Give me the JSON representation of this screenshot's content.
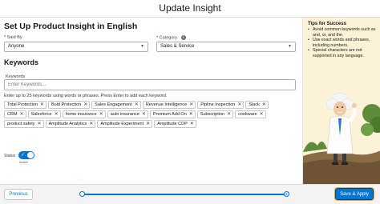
{
  "modal": {
    "title": "Update Insight"
  },
  "form": {
    "heading": "Set Up Product Insight in English",
    "said_by": {
      "required_mark": "*",
      "label": "Said By",
      "value": "Anyone"
    },
    "category": {
      "required_mark": "*",
      "label": "Category",
      "value": "Sales & Service",
      "info": "i"
    },
    "keywords_section": "Keywords",
    "keywords_label": "Keywords",
    "keywords_placeholder": "Enter Keywords...",
    "keywords_hint": "Enter up to 25 keywords using words or phrases. Press Enter to add each keyword.",
    "keywords": [
      "Total Protection",
      "Bold Protection",
      "Sales Engagement",
      "Revenue Intelligence",
      "Pipline Inspection",
      "Slack",
      "CRM",
      "Salesforce",
      "home insurance",
      "auto insurance",
      "Premium Add On",
      "Subscription",
      "cookware",
      "product safety",
      "Amplitude Analytics",
      "Amplitude Experiment",
      "Amplitude CDP"
    ],
    "remove_glyph": "✕",
    "status": {
      "label": "Status",
      "state_text": "Active",
      "checked": true,
      "check_glyph": "✓"
    }
  },
  "tips": {
    "title": "Tips for Success",
    "items": [
      "Avoid common keywords such as and, or, and the.",
      "Use exact words and phrases, including numbers.",
      "Special characters are not supported in any language."
    ]
  },
  "footer": {
    "previous_label": "Previous",
    "save_label": "Save & Apply",
    "progress_percent": 100
  },
  "colors": {
    "brand": "#0176d3",
    "sidebar_bg": "#fbf2d7",
    "focus_ring": "#f5a623"
  },
  "icons": {
    "sidebar_illustration": "einstein-mascot-illustration",
    "dropdown": "chevron-down-icon"
  }
}
